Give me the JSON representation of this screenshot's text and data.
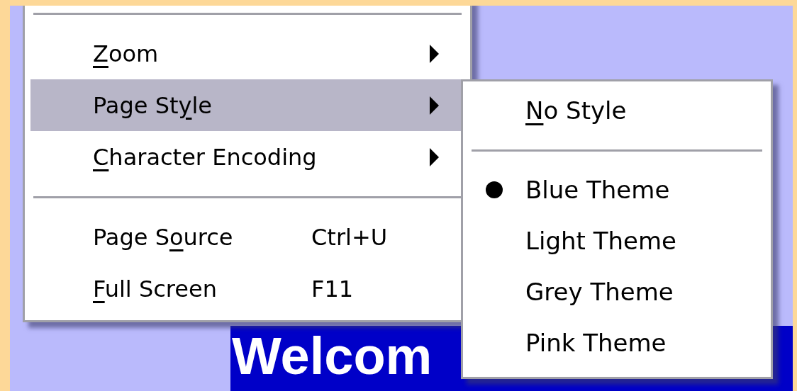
{
  "menu": {
    "items": [
      {
        "kind": "separator"
      },
      {
        "kind": "submenu",
        "label": {
          "key": "Z",
          "post": "oom"
        },
        "selected": false
      },
      {
        "kind": "submenu",
        "label": {
          "pre": "Page St",
          "key": "y",
          "post": "le"
        },
        "selected": true
      },
      {
        "kind": "submenu",
        "label": {
          "key": "C",
          "post": "haracter Encoding"
        },
        "selected": false
      },
      {
        "kind": "separator"
      },
      {
        "kind": "command",
        "label": {
          "pre": "Page S",
          "key": "o",
          "post": "urce"
        },
        "shortcut": "Ctrl+U",
        "selected": false
      },
      {
        "kind": "command",
        "label": {
          "key": "F",
          "post": "ull Screen"
        },
        "shortcut": "F11",
        "selected": false
      }
    ]
  },
  "submenu": {
    "items": [
      {
        "kind": "radio",
        "label": {
          "key": "N",
          "post": "o Style"
        },
        "checked": false
      },
      {
        "kind": "separator"
      },
      {
        "kind": "radio",
        "label": {
          "pre": "Blue Theme"
        },
        "checked": true
      },
      {
        "kind": "radio",
        "label": {
          "pre": "Light Theme"
        },
        "checked": false
      },
      {
        "kind": "radio",
        "label": {
          "pre": "Grey Theme"
        },
        "checked": false
      },
      {
        "kind": "radio",
        "label": {
          "pre": "Pink Theme"
        },
        "checked": false
      }
    ]
  },
  "banner": {
    "title": "Welcom"
  }
}
